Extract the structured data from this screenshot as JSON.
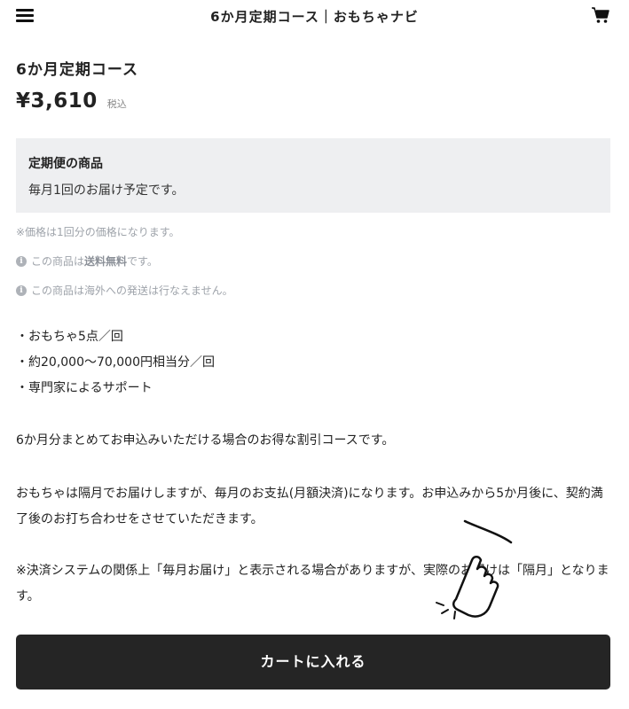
{
  "header": {
    "title": "6か月定期コース｜おもちゃナビ",
    "menu_icon": "hamburger-menu-icon",
    "cart_icon": "shopping-cart-icon"
  },
  "product": {
    "title": "6か月定期コース",
    "price": "¥3,610",
    "tax_label": "税込"
  },
  "subscription": {
    "title": "定期便の商品",
    "text": "毎月1回のお届け予定です。"
  },
  "notes": {
    "price_note": "※価格は1回分の価格になります。",
    "shipping_prefix": "この商品は",
    "shipping_bold": "送料無料",
    "shipping_suffix": "です。",
    "overseas": "この商品は海外への発送は行なえません。"
  },
  "features": [
    "・おもちゃ5点／回",
    "・約20,000〜70,000円相当分／回",
    "・専門家によるサポート"
  ],
  "description": {
    "p1": "6か月分まとめてお申込みいただける場合のお得な割引コースです。",
    "p2": "おもちゃは隔月でお届けしますが、毎月のお支払(月額決済)になります。お申込みから5か月後に、契約満了後のお打ち合わせをさせていただきます。",
    "p3": "※決済システムの関係上「毎月お届け」と表示される場合がありますが、実際のお届けは「隔月」となります。"
  },
  "cta": {
    "label": "カートに入れる"
  },
  "colors": {
    "button_bg": "#252525",
    "box_bg": "#eeeff1",
    "muted_text": "#9ea3aa"
  }
}
